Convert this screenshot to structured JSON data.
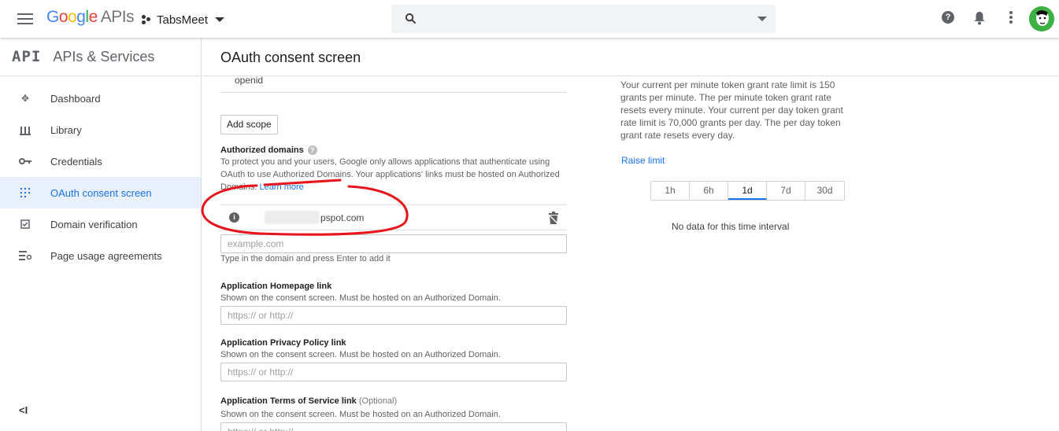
{
  "header": {
    "logo_google": [
      "G",
      "o",
      "o",
      "g",
      "l",
      "e"
    ],
    "logo_suffix": "APIs",
    "project_name": "TabsMeet",
    "search_placeholder": "",
    "icons": [
      "menu-icon",
      "search-icon",
      "help-icon",
      "notifications-icon",
      "more-vert-icon",
      "avatar"
    ]
  },
  "sidebar": {
    "logo": "API",
    "title": "APIs & Services",
    "items": [
      {
        "label": "Dashboard",
        "icon": "dashboard-icon",
        "active": false
      },
      {
        "label": "Library",
        "icon": "library-icon",
        "active": false
      },
      {
        "label": "Credentials",
        "icon": "key-icon",
        "active": false
      },
      {
        "label": "OAuth consent screen",
        "icon": "consent-icon",
        "active": true
      },
      {
        "label": "Domain verification",
        "icon": "checkbox-icon",
        "active": false
      },
      {
        "label": "Page usage agreements",
        "icon": "settings-list-icon",
        "active": false
      }
    ],
    "collapse_label": "<I"
  },
  "main": {
    "title": "OAuth consent screen",
    "scope_item": "openid",
    "add_scope_label": "Add scope",
    "authorized_domains": {
      "label": "Authorized domains",
      "description": "To protect you and your users, Google only allows applications that authenticate using OAuth to use Authorized Domains. Your applications' links must be hosted on Authorized Domains.",
      "learn_more": "Learn more",
      "domain_entry": "pspot.com",
      "input_placeholder": "example.com",
      "hint": "Type in the domain and press Enter to add it"
    },
    "homepage": {
      "label": "Application Homepage link",
      "description": "Shown on the consent screen. Must be hosted on an Authorized Domain.",
      "placeholder": "https:// or http://"
    },
    "privacy": {
      "label": "Application Privacy Policy link",
      "description": "Shown on the consent screen. Must be hosted on an Authorized Domain.",
      "placeholder": "https:// or http://"
    },
    "terms": {
      "label": "Application Terms of Service link",
      "optional": "(Optional)",
      "description": "Shown on the consent screen. Must be hosted on an Authorized Domain.",
      "placeholder": "https:// or http://"
    }
  },
  "right_panel": {
    "rate_text": "Your current per minute token grant rate limit is 150 grants per minute. The per minute token grant rate resets every minute. Your current per day token grant rate limit is 70,000 grants per day. The per day token grant rate resets every day.",
    "raise_limit": "Raise limit",
    "time_ranges": [
      "1h",
      "6h",
      "1d",
      "7d",
      "30d"
    ],
    "selected_range": "1d",
    "no_data": "No data for this time interval"
  },
  "colors": {
    "accent": "#1a73e8",
    "annotation": "#e8141c",
    "active_bg": "#e8f0fe"
  }
}
